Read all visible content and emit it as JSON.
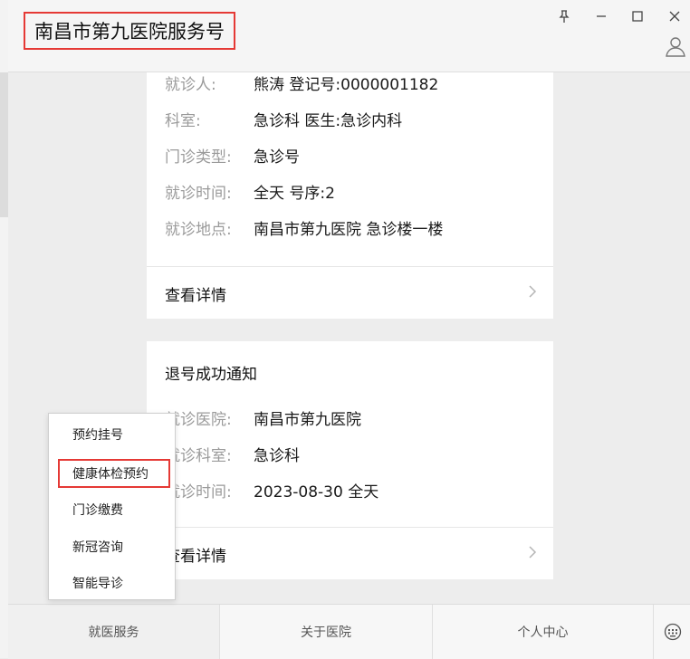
{
  "window": {
    "title": "南昌市第九医院服务号",
    "buttons": [
      "pin-icon",
      "minimize-icon",
      "maximize-icon",
      "close-icon"
    ],
    "avatar_icon": "person-icon",
    "highlight_color": "#e53935"
  },
  "cards": [
    {
      "fields": [
        {
          "label": "就诊人:",
          "value": "熊涛  登记号:0000001182"
        },
        {
          "label": "科室:",
          "value": "急诊科    医生:急诊内科"
        },
        {
          "label": "门诊类型:",
          "value": "急诊号"
        },
        {
          "label": "就诊时间:",
          "value": "全天 号序:2"
        },
        {
          "label": "就诊地点:",
          "value": "南昌市第九医院 急诊楼一楼"
        }
      ],
      "details": "查看详情"
    },
    {
      "title": "退号成功通知",
      "fields": [
        {
          "label": "就诊医院:",
          "value": "南昌市第九医院"
        },
        {
          "label": "就诊科室:",
          "value": "急诊科"
        },
        {
          "label": "就诊时间:",
          "value": "2023-08-30 全天"
        }
      ],
      "details": "查看详情"
    }
  ],
  "popup_menu": {
    "items": [
      "预约挂号",
      "健康体检预约",
      "门诊缴费",
      "新冠咨询",
      "智能导诊"
    ],
    "highlighted_index": 1
  },
  "tabbar": {
    "tabs": [
      "就医服务",
      "关于医院",
      "个人中心"
    ],
    "active_index": 0,
    "keyboard_icon": "keyboard-icon"
  }
}
